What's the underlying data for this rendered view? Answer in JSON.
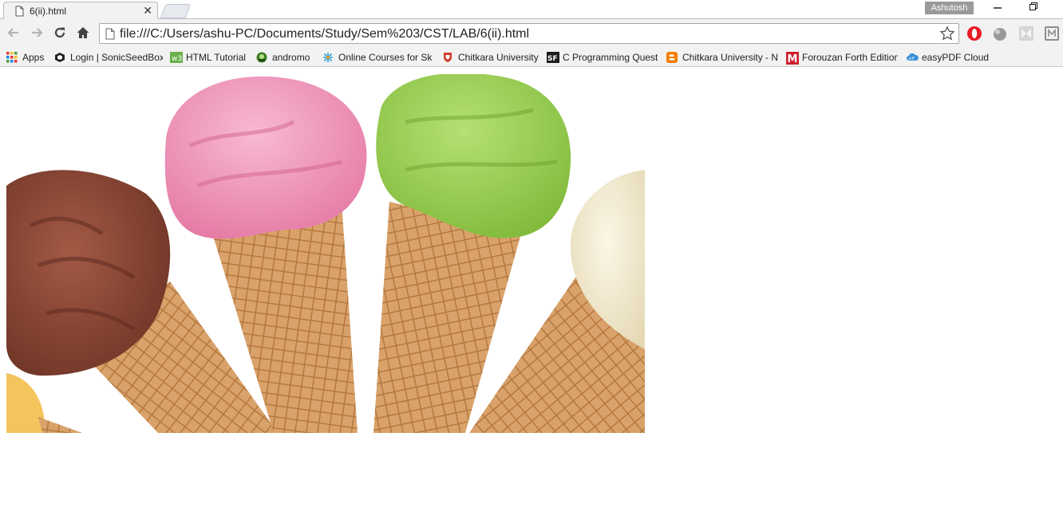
{
  "window": {
    "profile_name": "Ashutosh"
  },
  "tab": {
    "title": "6(ii).html"
  },
  "toolbar": {
    "url": "file:///C:/Users/ashu-PC/Documents/Study/Sem%203/CST/LAB/6(ii).html"
  },
  "bookmarks": [
    {
      "label": "Apps",
      "icon": "apps-grid-icon"
    },
    {
      "label": "Login | SonicSeedBox",
      "icon": "sonicseedbox-icon"
    },
    {
      "label": "HTML Tutorial",
      "icon": "w3schools-icon"
    },
    {
      "label": "andromo",
      "icon": "andromo-icon"
    },
    {
      "label": "Online Courses for Sk",
      "icon": "online-courses-icon"
    },
    {
      "label": "Chitkara University",
      "icon": "chitkara-shield-icon"
    },
    {
      "label": "C Programming Quest",
      "icon": "sanfoundry-icon"
    },
    {
      "label": "Chitkara University - N",
      "icon": "blogger-icon"
    },
    {
      "label": "Forouzan Forth Edition",
      "icon": "m-logo-icon"
    },
    {
      "label": "easyPDF Cloud",
      "icon": "easypdf-cloud-icon"
    }
  ],
  "colors": {
    "chrome_bg": "#f2f2f2",
    "chocolate": "#8b4a3a",
    "strawberry": "#f29bc0",
    "pistachio": "#9ccf52",
    "vanilla": "#f3ead1",
    "cone": "#d69c5d"
  }
}
